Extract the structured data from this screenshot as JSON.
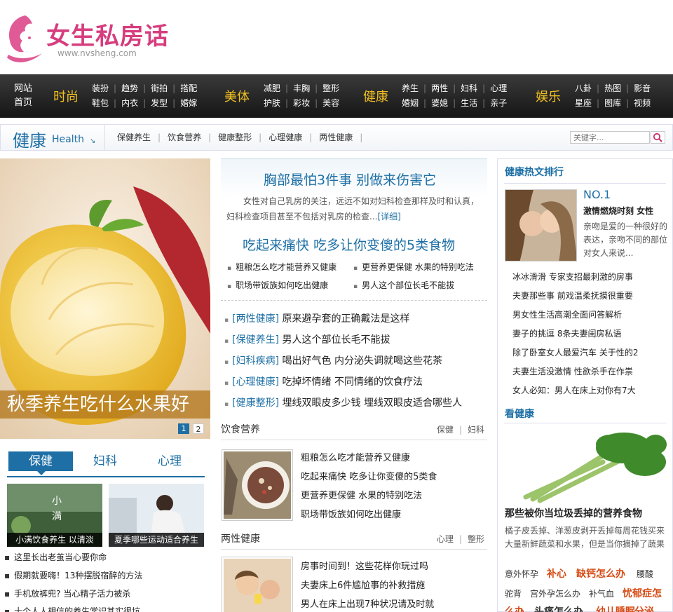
{
  "header": {
    "logo_text": "女生私房话",
    "logo_url": "www.nvsheng.com"
  },
  "nav": {
    "home": [
      "网站",
      "首页"
    ],
    "groups": [
      {
        "cat": "时尚",
        "row1": [
          "装扮",
          "趋势",
          "街拍",
          "搭配"
        ],
        "row2": [
          "鞋包",
          "内衣",
          "发型",
          "婚嫁"
        ]
      },
      {
        "cat": "美体",
        "row1": [
          "减肥",
          "丰胸",
          "整形"
        ],
        "row2": [
          "护肤",
          "彩妆",
          "美容"
        ]
      },
      {
        "cat": "健康",
        "row1": [
          "养生",
          "两性",
          "妇科",
          "心理"
        ],
        "row2": [
          "婚姻",
          "婆媳",
          "生活",
          "亲子"
        ]
      },
      {
        "cat": "娱乐",
        "row1": [
          "八卦",
          "热图",
          "影音"
        ],
        "row2": [
          "星座",
          "图库",
          "视频"
        ]
      }
    ]
  },
  "channel": {
    "title": "健康",
    "subtitle": "Health",
    "links": [
      "保健养生",
      "饮食营养",
      "健康整形",
      "心理健康",
      "两性健康"
    ],
    "search_placeholder": "关键字..."
  },
  "hero": {
    "caption": "秋季养生吃什么水果好",
    "pages": [
      "1",
      "2"
    ]
  },
  "tabs": {
    "labels": [
      "保健",
      "妇科",
      "心理"
    ],
    "thumbs": [
      "小满饮食养生 以清淡",
      "夏季哪些运动适合养生"
    ],
    "thumb_text": "小满",
    "items": [
      "这里长出老茧当心要你命",
      "假期就要嗨！13种摆脱宿醉的方法",
      "手机放裤兜? 当心精子活力被杀",
      "十个人人相信的养生常识其实很坑"
    ]
  },
  "feature": {
    "headline1": "胸部最怕3件事 别做来伤害它",
    "desc": "女性对自己乳房的关注，远远不如对妇科检查那样及时和认真，妇科检查项目甚至不包括对乳房的检查...",
    "detail_link": "[详细]",
    "headline2": "吃起来痛快 吃多让你变傻的5类食物",
    "links": [
      "粗粮怎么吃才能营养又健康",
      "更营养更保健 水果的特别吃法",
      "职场带饭族如何吃出健康",
      "男人这个部位长毛不能拔"
    ]
  },
  "tagged": [
    {
      "tag": "[两性健康]",
      "text": "原来避孕套的正确戴法是这样"
    },
    {
      "tag": "[保健养生]",
      "text": "男人这个部位长毛不能拔"
    },
    {
      "tag": "[妇科疾病]",
      "text": "喝出好气色 内分泌失调就喝这些花茶"
    },
    {
      "tag": "[心理健康]",
      "text": "吃掉坏情绪 不同情绪的饮食疗法"
    },
    {
      "tag": "[健康整形]",
      "text": "埋线双眼皮多少钱 埋线双眼皮适合哪些人"
    }
  ],
  "sections": [
    {
      "title": "饮食营养",
      "links": [
        "保健",
        "妇科"
      ],
      "items": [
        "粗粮怎么吃才能营养又健康",
        "吃起来痛快 吃多让你变傻的5类食",
        "更营养更保健 水果的特别吃法",
        "职场带饭族如何吃出健康"
      ]
    },
    {
      "title": "两性健康",
      "links": [
        "心理",
        "整形"
      ],
      "items": [
        "房事时间到！这些花样你玩过吗",
        "夫妻床上6件尴尬事的补救措施",
        "男人在床上出现7种状况请及时就"
      ]
    }
  ],
  "right": {
    "hot_title": "健康热文排行",
    "no1_rank": "NO.1",
    "no1_title": "激情燃烧时刻 女性",
    "no1_desc": "亲吻是爱的一种很好的表达，亲吻不同的部位对女人来说...",
    "hot_items": [
      "冰冰滑滑 专家支招最刺激的房事",
      "夫妻那些事 前戏温柔抚摸很重要",
      "男女性生活高潮全面问答解析",
      "妻子的挑逗 8条夫妻闺房私语",
      "除了卧室女人最爱汽车 关于性的2",
      "夫妻生活没激情 性欲杀手在作祟",
      "女人必知：男人在床上对你有7大"
    ],
    "see_title": "看健康",
    "see_img_title": "那些被你当垃圾丢掉的营养食物",
    "see_desc": "橘子皮丢掉、洋葱皮剥开丢掉每周花钱买来大量新鲜蔬菜和水果，但是当你摘掉了蔬果",
    "keywords_row1": [
      "意外怀孕",
      "补心",
      "缺钙怎么办",
      "腰酸"
    ],
    "keywords_row2": [
      "驼背",
      "宫外孕怎么办",
      "补气血",
      "忧郁症怎"
    ],
    "keywords_row3": [
      "么办",
      "头痛怎么办",
      "幼儿睡眠",
      "分泌"
    ]
  }
}
